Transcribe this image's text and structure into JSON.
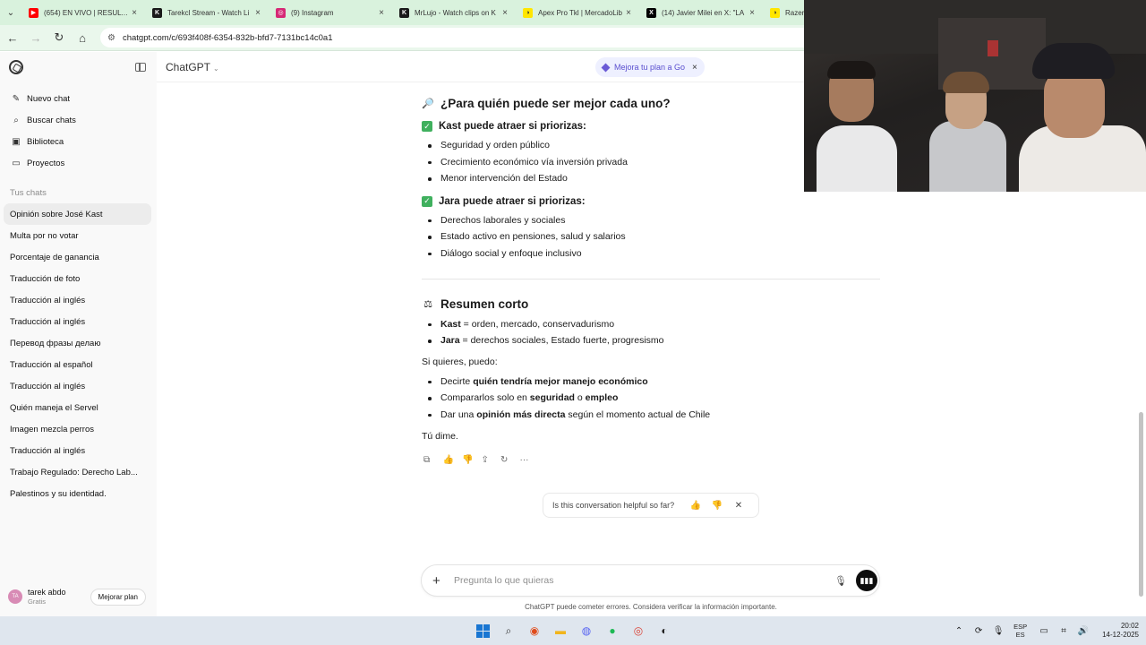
{
  "browser": {
    "tabs": [
      {
        "title": "(654) EN VIVO | RESULTAD",
        "favicon_color": "#ff0000",
        "favicon_glyph": "▶"
      },
      {
        "title": "Tarekcl Stream - Watch Li",
        "favicon_color": "#1a1a1a",
        "favicon_glyph": "K"
      },
      {
        "title": "(9) Instagram",
        "favicon_color": "#d62976",
        "favicon_glyph": "◎"
      },
      {
        "title": "MrLujo - Watch clips on K",
        "favicon_color": "#1a1a1a",
        "favicon_glyph": "K"
      },
      {
        "title": "Apex Pro Tkl | MercadoLib",
        "favicon_color": "#ffe600",
        "favicon_glyph": "◑"
      },
      {
        "title": "(14) Javier Milei en X: \"LA",
        "favicon_color": "#000000",
        "favicon_glyph": "X"
      },
      {
        "title": "Razer",
        "favicon_color": "#ffe600",
        "favicon_glyph": "◑"
      }
    ],
    "url": "chatgpt.com/c/693f408f-6354-832b-bfd7-7131bc14c0a1"
  },
  "sidebar": {
    "nav": [
      {
        "label": "Nuevo chat",
        "icon": "new-chat-icon",
        "glyph": "✎"
      },
      {
        "label": "Buscar chats",
        "icon": "search-icon",
        "glyph": "⌕"
      },
      {
        "label": "Biblioteca",
        "icon": "library-icon",
        "glyph": "▣"
      },
      {
        "label": "Proyectos",
        "icon": "folder-icon",
        "glyph": "▭"
      }
    ],
    "section_label": "Tus chats",
    "chats": [
      "Opinión sobre José Kast",
      "Multa por no votar",
      "Porcentaje de ganancia",
      "Traducción de foto",
      "Traducción al inglés",
      "Traducción al inglés",
      "Перевод фразы делаю",
      "Traducción al español",
      "Traducción al inglés",
      "Quién maneja el Servel",
      "Imagen mezcla perros",
      "Traducción al inglés",
      "Trabajo Regulado: Derecho Lab...",
      "Palestinos y su identidad."
    ],
    "user": {
      "initials": "TA",
      "name": "tarek abdo",
      "plan": "Gratis",
      "upgrade_label": "Mejorar plan"
    }
  },
  "header": {
    "model": "ChatGPT",
    "promo": "Mejora tu plan a Go"
  },
  "message": {
    "heading": "¿Para quién puede ser mejor cada uno?",
    "kast_heading": "Kast puede atraer si priorizas:",
    "kast_items": [
      "Seguridad y orden público",
      "Crecimiento económico vía inversión privada",
      "Menor intervención del Estado"
    ],
    "jara_heading": "Jara puede atraer si priorizas:",
    "jara_items": [
      "Derechos laborales y sociales",
      "Estado activo en pensiones, salud y salarios",
      "Diálogo social y enfoque inclusivo"
    ],
    "summary_heading": "Resumen corto",
    "summary": [
      {
        "bold": "Kast",
        "rest": " = orden, mercado, conservadurismo"
      },
      {
        "bold": "Jara",
        "rest": " = derechos sociales, Estado fuerte, progresismo"
      }
    ],
    "offer_intro": "Si quieres, puedo:",
    "offers": [
      {
        "pre": "Decirte ",
        "bold": "quién tendría mejor manejo económico",
        "mid": "",
        "bold2": "",
        "post": ""
      },
      {
        "pre": "Compararlos solo en ",
        "bold": "seguridad",
        "mid": " o ",
        "bold2": "empleo",
        "post": ""
      },
      {
        "pre": "Dar una ",
        "bold": "opinión más directa",
        "mid": "",
        "bold2": "",
        "post": " según el momento actual de Chile"
      }
    ],
    "closing": "Tú dime."
  },
  "feedback": {
    "question": "Is this conversation helpful so far?"
  },
  "composer": {
    "placeholder": "Pregunta lo que quieras"
  },
  "disclaimer": "ChatGPT puede cometer errores. Considera verificar la información importante.",
  "taskbar": {
    "lang_line1": "ESP",
    "lang_line2": "ES",
    "time": "20:02",
    "date": "14-12-2025"
  }
}
